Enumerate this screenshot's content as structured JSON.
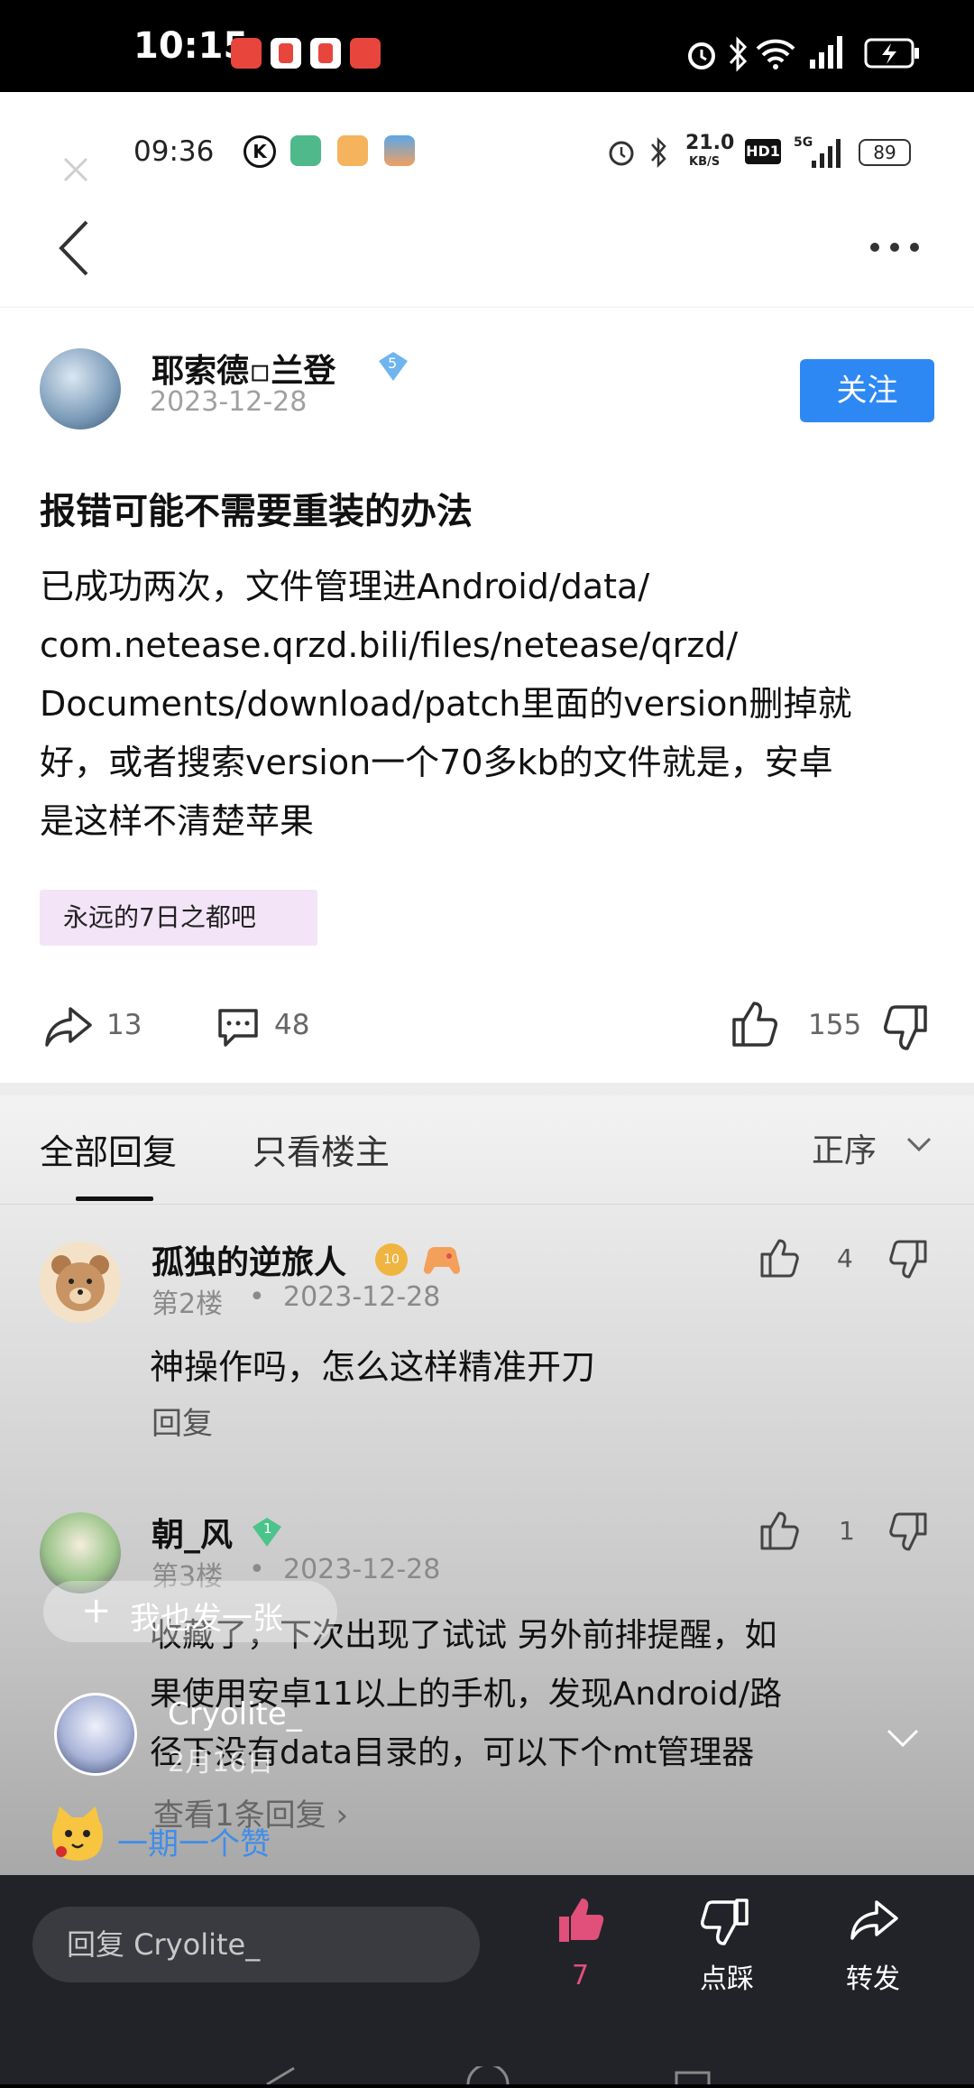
{
  "status_bar": {
    "time": "10:15"
  },
  "inner_status_bar": {
    "time": "09:36",
    "speed_value": "21.0",
    "speed_unit": "KB/S",
    "hd": "HD1",
    "net": "5G",
    "battery": "89"
  },
  "post": {
    "author": "耶索德▫兰登",
    "author_level": "5",
    "date": "2023-12-28",
    "follow_label": "关注",
    "title": "报错可能不需要重装的办法",
    "body_lines": [
      "已成功两次，文件管理进Android/data/",
      "com.netease.qrzd.bili/files/netease/qrzd/",
      "Documents/download/patch里面的version删掉就",
      "好，或者搜索version一个70多kb的文件就是，安卓",
      "是这样不清楚苹果"
    ],
    "tag": "永远的7日之都吧",
    "shares": "13",
    "comments": "48",
    "likes": "155"
  },
  "tabs": {
    "all": "全部回复",
    "owner_only": "只看楼主",
    "sort": "正序"
  },
  "replies": [
    {
      "name": "孤独的逆旅人",
      "level": "10",
      "floor": "第2楼",
      "date": "2023-12-28",
      "likes": "4",
      "text": "神操作吗，怎么这样精准开刀",
      "reply_label": "回复"
    },
    {
      "name": "朝_风",
      "level": "1",
      "floor": "第3楼",
      "date": "2023-12-28",
      "likes": "1",
      "text_lines": [
        "收藏了，下次出现了试试 另外前排提醒，如",
        "果使用安卓11以上的手机，发现Android/路",
        "径下没有data目录的，可以下个mt管理器"
      ],
      "view_more": "查看1条回复"
    }
  ],
  "overlay": {
    "post_also": "我也发一张",
    "user_name": "Cryolite_",
    "user_date": "2月16日",
    "cheer": "一期一个赞"
  },
  "bottom_bar": {
    "reply_placeholder": "回复 Cryolite_",
    "like_count": "7",
    "dislike_label": "点踩",
    "share_label": "转发"
  },
  "colors": {
    "accent": "#2e88f4",
    "like_active": "#e0507a",
    "tag_bg": "#f3e4f8"
  }
}
